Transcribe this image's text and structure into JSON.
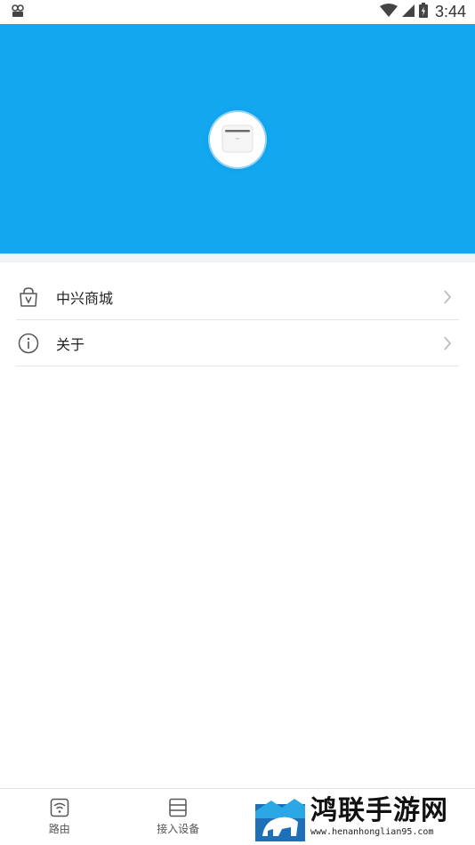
{
  "status_bar": {
    "time": "3:44"
  },
  "menu": {
    "items": [
      {
        "label": "中兴商城",
        "icon": "shopping-bag-icon"
      },
      {
        "label": "关于",
        "icon": "info-icon"
      }
    ]
  },
  "bottom_nav": {
    "tabs": [
      {
        "label": "路由",
        "icon": "router-icon"
      },
      {
        "label": "接入设备",
        "icon": "device-list-icon"
      }
    ]
  },
  "watermark": {
    "title": "鸿联手游网",
    "url": "www.henanhonglian95.com"
  },
  "colors": {
    "header": "#13a7f0",
    "background": "#ffffff",
    "divider": "#e4e4e4"
  }
}
